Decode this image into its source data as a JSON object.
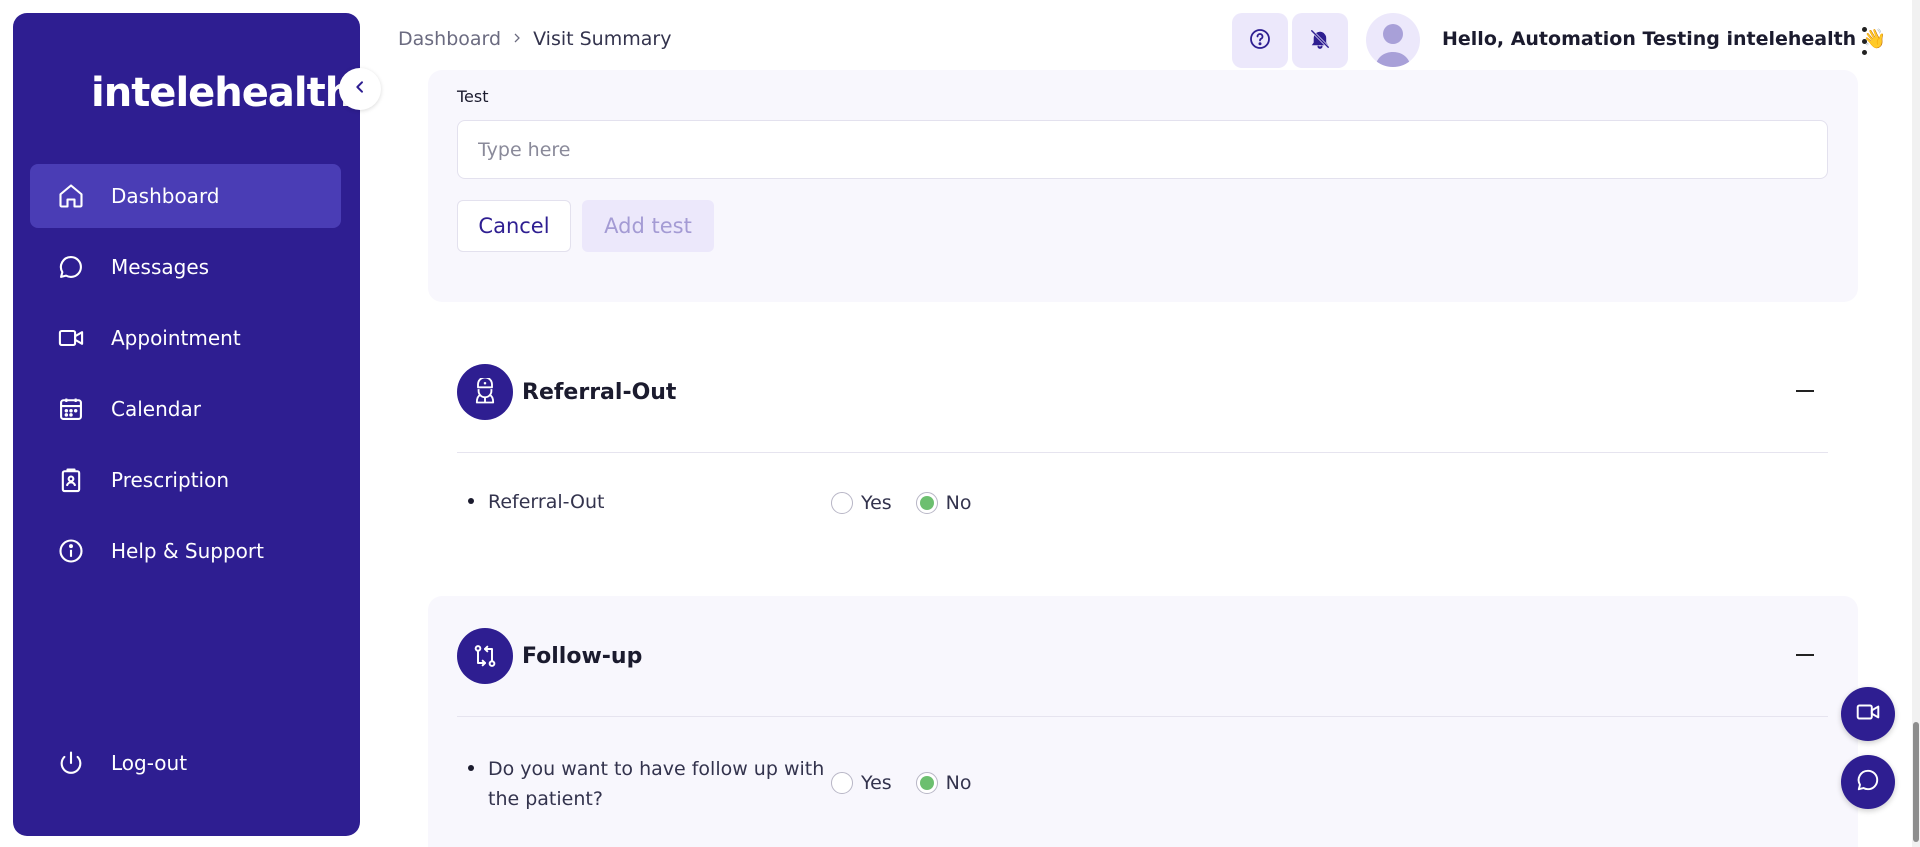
{
  "sidebar": {
    "logo_text": "intelehealth",
    "items": [
      {
        "label": "Dashboard",
        "icon": "home-icon",
        "active": true
      },
      {
        "label": "Messages",
        "icon": "message-icon"
      },
      {
        "label": "Appointment",
        "icon": "video-icon"
      },
      {
        "label": "Calendar",
        "icon": "calendar-icon"
      },
      {
        "label": "Prescription",
        "icon": "clipboard-icon"
      },
      {
        "label": "Help & Support",
        "icon": "info-icon"
      }
    ],
    "logout_label": "Log-out"
  },
  "header": {
    "breadcrumb": [
      "Dashboard",
      "Visit Summary"
    ],
    "greeting": "Hello, Automation Testing intelehealth 👋"
  },
  "test_section": {
    "label": "Test",
    "placeholder": "Type here",
    "cancel_label": "Cancel",
    "add_label": "Add test"
  },
  "referral": {
    "title": "Referral-Out",
    "question": "Referral-Out",
    "options": [
      "Yes",
      "No"
    ],
    "selected": "No"
  },
  "followup": {
    "title": "Follow-up",
    "question": "Do you want to have follow up with the patient?",
    "options": [
      "Yes",
      "No"
    ],
    "selected": "No"
  },
  "colors": {
    "brand": "#2e1e91",
    "active_nav": "#4a3db5",
    "radio_selected": "#6cbf6f"
  }
}
